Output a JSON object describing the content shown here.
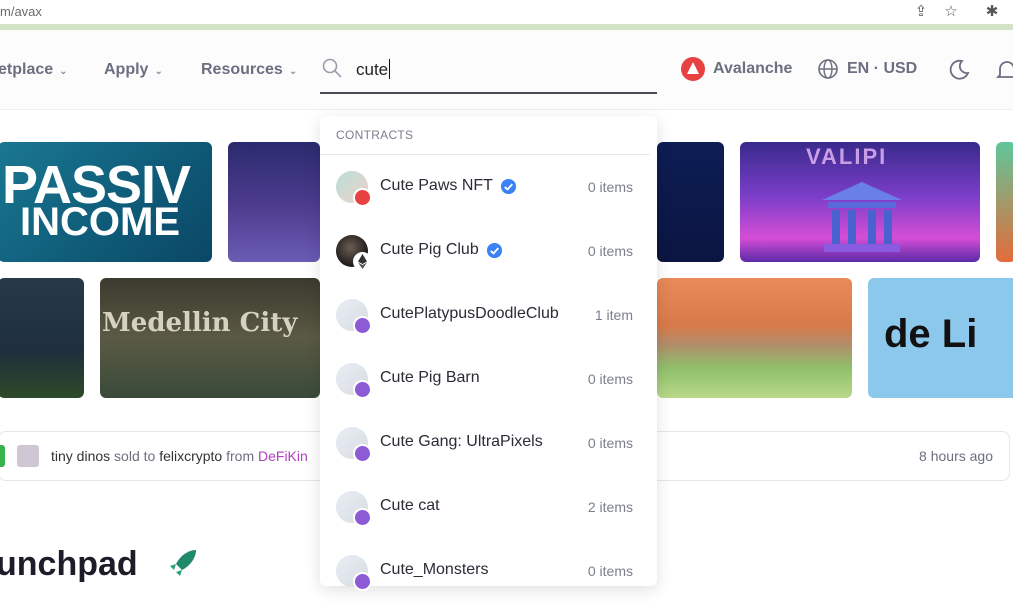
{
  "browser": {
    "url": "m/avax"
  },
  "nav": {
    "items": [
      {
        "label": "etplace"
      },
      {
        "label": "Apply"
      },
      {
        "label": "Resources"
      }
    ],
    "search_value": "cute",
    "chain_label": "Avalanche",
    "lang_label": "EN · USD"
  },
  "banners": {
    "passive_line1": "PASSIV",
    "passive_line2": "INCOME",
    "valipi_logo": "VALIPI",
    "medellin_title": "Medellin City",
    "lion_text": "de Li"
  },
  "activity": {
    "item": "tiny dinos",
    "sold_to": "sold to",
    "buyer": "felixcrypto",
    "from": "from",
    "source": "DeFiKin",
    "time": "8 hours ago"
  },
  "launchpad_title": "unchpad",
  "dropdown": {
    "header": "CONTRACTS",
    "items": [
      {
        "name": "Cute Paws NFT",
        "verified": true,
        "count": "0 items",
        "badge": "avax"
      },
      {
        "name": "Cute Pig Club",
        "verified": true,
        "count": "0 items",
        "badge": "eth"
      },
      {
        "name": "CutePlatypusDoodleClub",
        "verified": false,
        "count": "1 item",
        "badge": "link"
      },
      {
        "name": "Cute Pig Barn",
        "verified": false,
        "count": "0 items",
        "badge": "link"
      },
      {
        "name": "Cute Gang: UltraPixels",
        "verified": false,
        "count": "0 items",
        "badge": "link"
      },
      {
        "name": "Cute cat",
        "verified": false,
        "count": "2 items",
        "badge": "link"
      },
      {
        "name": "Cute_Monsters",
        "verified": false,
        "count": "0 items",
        "badge": "link"
      }
    ]
  },
  "colors": {
    "accent_red": "#e84142",
    "verified_blue": "#3b82f6",
    "badge_purple": "#8e5bd6",
    "link_pink": "#b13fc2"
  }
}
